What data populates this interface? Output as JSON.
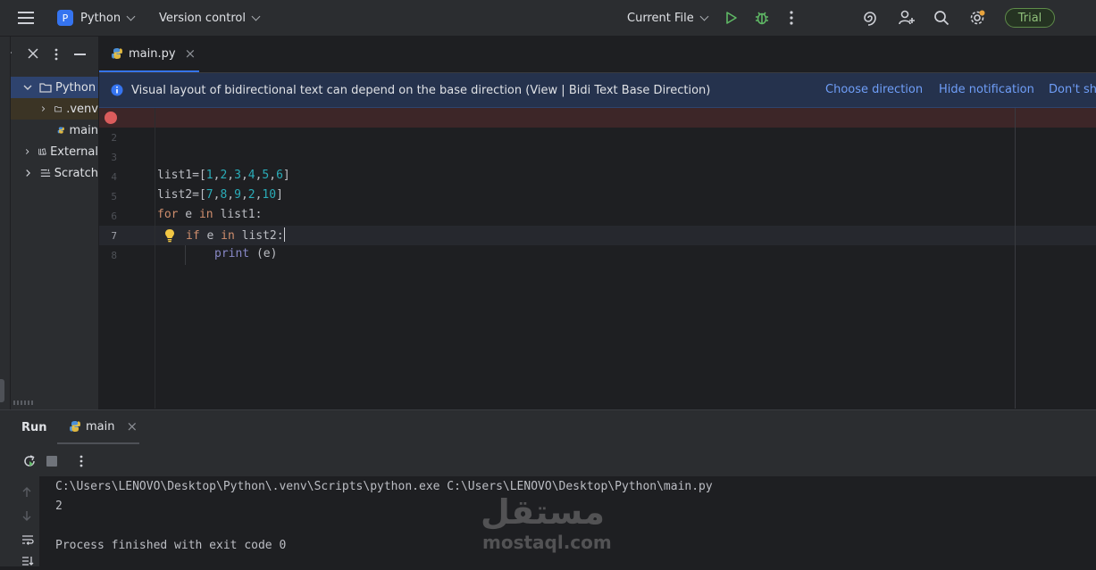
{
  "titlebar": {
    "project_badge": "P",
    "project_name": "Python",
    "vcs": "Version control",
    "run_config": "Current File",
    "trial": "Trial"
  },
  "project_tree": [
    {
      "label": "Python",
      "kind": "folder",
      "expanded": true
    },
    {
      "label": ".venv",
      "kind": "folder",
      "expanded": false
    },
    {
      "label": "main",
      "kind": "python-file"
    },
    {
      "label": "External",
      "kind": "library",
      "expanded": false
    },
    {
      "label": "Scratch",
      "kind": "scratch",
      "expanded": false
    }
  ],
  "editor_tab": {
    "label": "main.py",
    "close": "×"
  },
  "notification": {
    "message": "Visual layout of bidirectional text can depend on the base direction (View | Bidi Text Base Direction)",
    "link_choose": "Choose direction",
    "link_hide": "Hide notification",
    "link_dont": "Don't show again"
  },
  "editor": {
    "line_numbers": [
      "2",
      "3",
      "4",
      "5",
      "6",
      "7",
      "8"
    ],
    "current_line": "7",
    "code": {
      "l4": {
        "a": "list1=[",
        "n1": "1",
        "n2": "2",
        "n3": "3",
        "n4": "4",
        "n5": "5",
        "n6": "6",
        "end": "]",
        "sep": ","
      },
      "l5": {
        "a": "list2=[",
        "n1": "7",
        "n2": "8",
        "n3": "9",
        "n4": "2",
        "n5": "10",
        "end": "]",
        "sep": ","
      },
      "l6": {
        "kw1": "for",
        "v": " e ",
        "kw2": "in",
        "rest": " list1:"
      },
      "l7": {
        "kw1": "if",
        "v": " e ",
        "kw2": "in",
        "rest": " list2:"
      },
      "l8": {
        "fn": "print",
        "rest": " (e)"
      }
    }
  },
  "run": {
    "title": "Run",
    "tab_label": "main",
    "tab_close": "×",
    "output": [
      "C:\\Users\\LENOVO\\Desktop\\Python\\.venv\\Scripts\\python.exe C:\\Users\\LENOVO\\Desktop\\Python\\main.py",
      "2",
      "",
      "Process finished with exit code 0"
    ]
  },
  "watermark": {
    "arabic": "مستقل",
    "latin": "mostaql.com"
  },
  "colors": {
    "accent": "#3574f0",
    "breakpoint": "#db5c5c",
    "run_green": "#5fb865",
    "keyword": "#cf8e6d",
    "number": "#2aacb8",
    "builtin": "#8888c6"
  }
}
